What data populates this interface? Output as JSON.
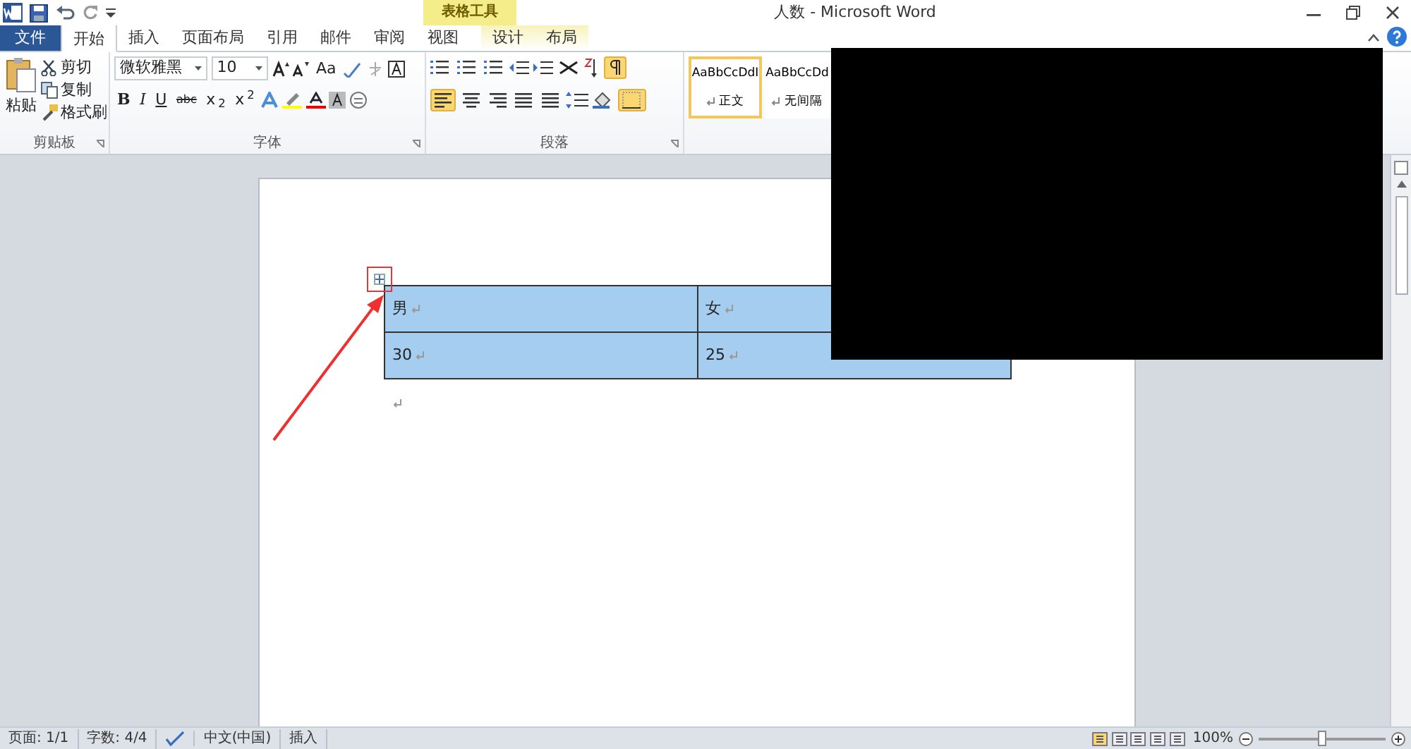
{
  "window": {
    "title": "人数 - Microsoft Word"
  },
  "contextual_tab_group": {
    "label": "表格工具"
  },
  "tabs": [
    {
      "label": "文件",
      "kind": "file",
      "selected": false
    },
    {
      "label": "开始",
      "kind": "tab",
      "selected": true
    },
    {
      "label": "插入",
      "kind": "tab",
      "selected": false
    },
    {
      "label": "页面布局",
      "kind": "tab",
      "selected": false
    },
    {
      "label": "引用",
      "kind": "tab",
      "selected": false
    },
    {
      "label": "邮件",
      "kind": "tab",
      "selected": false
    },
    {
      "label": "审阅",
      "kind": "tab",
      "selected": false
    },
    {
      "label": "视图",
      "kind": "tab",
      "selected": false
    },
    {
      "label": "设计",
      "kind": "context",
      "selected": false
    },
    {
      "label": "布局",
      "kind": "context",
      "selected": false
    }
  ],
  "clipboard": {
    "label": "剪贴板",
    "paste": "粘贴",
    "actions": [
      "剪切",
      "复制",
      "格式刷"
    ]
  },
  "font": {
    "label": "字体",
    "font_name": "微软雅黑",
    "font_size": "10",
    "case_button": "Aa",
    "format_buttons": [
      "B",
      "I",
      "U",
      "abc",
      "x$_{2}$",
      "x$^{2}$"
    ]
  },
  "paragraph": {
    "label": "段落",
    "alignments": [
      {
        "selected": true
      },
      {
        "selected": false
      },
      {
        "selected": false
      },
      {
        "selected": false
      },
      {
        "selected": false
      }
    ],
    "show_marks": {
      "selected": true
    },
    "borders": {
      "selected": true
    }
  },
  "styles": [
    {
      "preview": "AaBbCcDdI",
      "label": "正文",
      "selected": true
    },
    {
      "preview": "AaBbCcDd",
      "label": "无间隔",
      "selected": false
    }
  ],
  "table": {
    "rows": [
      [
        "男",
        "女"
      ],
      [
        "30",
        "25"
      ]
    ]
  },
  "status_bar": {
    "page": "页面: 1/1",
    "words": "字数: 4/4",
    "language": "中文(中国)",
    "mode": "插入",
    "zoom": "100%",
    "zoom_slider": {
      "level": 0.5
    }
  }
}
